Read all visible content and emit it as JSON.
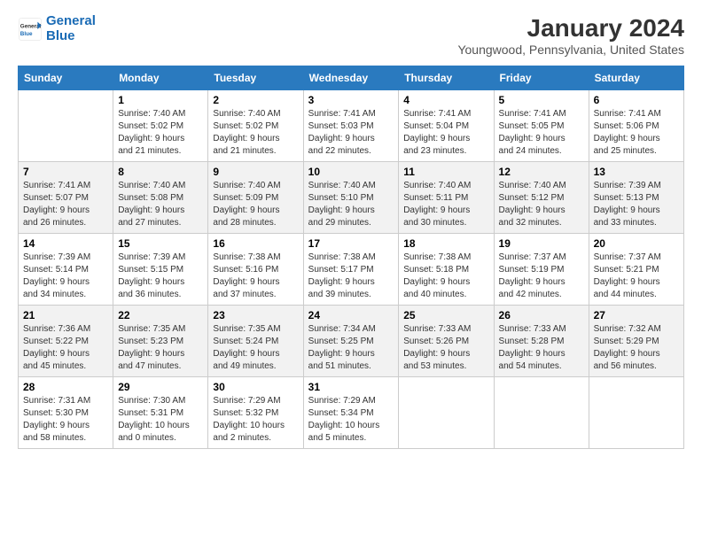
{
  "header": {
    "logo_line1": "General",
    "logo_line2": "Blue",
    "month": "January 2024",
    "location": "Youngwood, Pennsylvania, United States"
  },
  "days_of_week": [
    "Sunday",
    "Monday",
    "Tuesday",
    "Wednesday",
    "Thursday",
    "Friday",
    "Saturday"
  ],
  "weeks": [
    [
      {
        "num": "",
        "info": ""
      },
      {
        "num": "1",
        "info": "Sunrise: 7:40 AM\nSunset: 5:02 PM\nDaylight: 9 hours\nand 21 minutes."
      },
      {
        "num": "2",
        "info": "Sunrise: 7:40 AM\nSunset: 5:02 PM\nDaylight: 9 hours\nand 21 minutes."
      },
      {
        "num": "3",
        "info": "Sunrise: 7:41 AM\nSunset: 5:03 PM\nDaylight: 9 hours\nand 22 minutes."
      },
      {
        "num": "4",
        "info": "Sunrise: 7:41 AM\nSunset: 5:04 PM\nDaylight: 9 hours\nand 23 minutes."
      },
      {
        "num": "5",
        "info": "Sunrise: 7:41 AM\nSunset: 5:05 PM\nDaylight: 9 hours\nand 24 minutes."
      },
      {
        "num": "6",
        "info": "Sunrise: 7:41 AM\nSunset: 5:06 PM\nDaylight: 9 hours\nand 25 minutes."
      }
    ],
    [
      {
        "num": "7",
        "info": "Sunrise: 7:41 AM\nSunset: 5:07 PM\nDaylight: 9 hours\nand 26 minutes."
      },
      {
        "num": "8",
        "info": "Sunrise: 7:40 AM\nSunset: 5:08 PM\nDaylight: 9 hours\nand 27 minutes."
      },
      {
        "num": "9",
        "info": "Sunrise: 7:40 AM\nSunset: 5:09 PM\nDaylight: 9 hours\nand 28 minutes."
      },
      {
        "num": "10",
        "info": "Sunrise: 7:40 AM\nSunset: 5:10 PM\nDaylight: 9 hours\nand 29 minutes."
      },
      {
        "num": "11",
        "info": "Sunrise: 7:40 AM\nSunset: 5:11 PM\nDaylight: 9 hours\nand 30 minutes."
      },
      {
        "num": "12",
        "info": "Sunrise: 7:40 AM\nSunset: 5:12 PM\nDaylight: 9 hours\nand 32 minutes."
      },
      {
        "num": "13",
        "info": "Sunrise: 7:39 AM\nSunset: 5:13 PM\nDaylight: 9 hours\nand 33 minutes."
      }
    ],
    [
      {
        "num": "14",
        "info": "Sunrise: 7:39 AM\nSunset: 5:14 PM\nDaylight: 9 hours\nand 34 minutes."
      },
      {
        "num": "15",
        "info": "Sunrise: 7:39 AM\nSunset: 5:15 PM\nDaylight: 9 hours\nand 36 minutes."
      },
      {
        "num": "16",
        "info": "Sunrise: 7:38 AM\nSunset: 5:16 PM\nDaylight: 9 hours\nand 37 minutes."
      },
      {
        "num": "17",
        "info": "Sunrise: 7:38 AM\nSunset: 5:17 PM\nDaylight: 9 hours\nand 39 minutes."
      },
      {
        "num": "18",
        "info": "Sunrise: 7:38 AM\nSunset: 5:18 PM\nDaylight: 9 hours\nand 40 minutes."
      },
      {
        "num": "19",
        "info": "Sunrise: 7:37 AM\nSunset: 5:19 PM\nDaylight: 9 hours\nand 42 minutes."
      },
      {
        "num": "20",
        "info": "Sunrise: 7:37 AM\nSunset: 5:21 PM\nDaylight: 9 hours\nand 44 minutes."
      }
    ],
    [
      {
        "num": "21",
        "info": "Sunrise: 7:36 AM\nSunset: 5:22 PM\nDaylight: 9 hours\nand 45 minutes."
      },
      {
        "num": "22",
        "info": "Sunrise: 7:35 AM\nSunset: 5:23 PM\nDaylight: 9 hours\nand 47 minutes."
      },
      {
        "num": "23",
        "info": "Sunrise: 7:35 AM\nSunset: 5:24 PM\nDaylight: 9 hours\nand 49 minutes."
      },
      {
        "num": "24",
        "info": "Sunrise: 7:34 AM\nSunset: 5:25 PM\nDaylight: 9 hours\nand 51 minutes."
      },
      {
        "num": "25",
        "info": "Sunrise: 7:33 AM\nSunset: 5:26 PM\nDaylight: 9 hours\nand 53 minutes."
      },
      {
        "num": "26",
        "info": "Sunrise: 7:33 AM\nSunset: 5:28 PM\nDaylight: 9 hours\nand 54 minutes."
      },
      {
        "num": "27",
        "info": "Sunrise: 7:32 AM\nSunset: 5:29 PM\nDaylight: 9 hours\nand 56 minutes."
      }
    ],
    [
      {
        "num": "28",
        "info": "Sunrise: 7:31 AM\nSunset: 5:30 PM\nDaylight: 9 hours\nand 58 minutes."
      },
      {
        "num": "29",
        "info": "Sunrise: 7:30 AM\nSunset: 5:31 PM\nDaylight: 10 hours\nand 0 minutes."
      },
      {
        "num": "30",
        "info": "Sunrise: 7:29 AM\nSunset: 5:32 PM\nDaylight: 10 hours\nand 2 minutes."
      },
      {
        "num": "31",
        "info": "Sunrise: 7:29 AM\nSunset: 5:34 PM\nDaylight: 10 hours\nand 5 minutes."
      },
      {
        "num": "",
        "info": ""
      },
      {
        "num": "",
        "info": ""
      },
      {
        "num": "",
        "info": ""
      }
    ]
  ]
}
